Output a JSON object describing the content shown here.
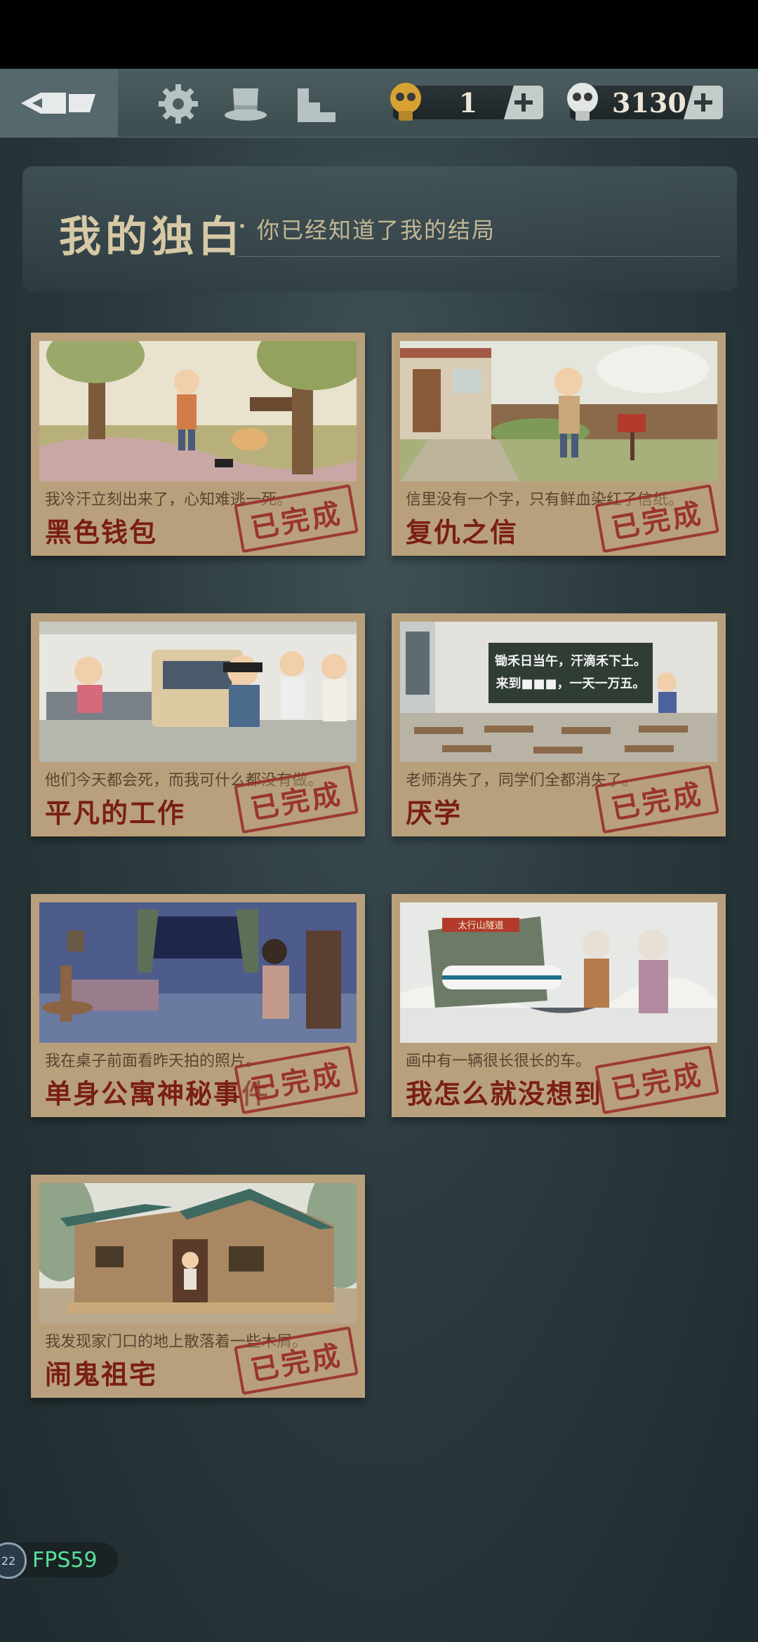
{
  "header": {
    "title": "我的独白",
    "subtitle": "你已经知道了我的结局"
  },
  "currency": {
    "hint": "1",
    "coins": "3130",
    "plus_label": "+"
  },
  "icons": {
    "back": "pen-nib-back-icon",
    "settings": "gear-icon",
    "hat": "top-hat-icon",
    "rank": "stairs-icon",
    "hint": "lightbulb-icon",
    "coin": "lightbulb-coin-icon"
  },
  "stamp_text": "已完成",
  "cards": [
    {
      "desc": "我冷汗立刻出来了，心知难逃一死。",
      "title": "黑色钱包",
      "status": "已完成"
    },
    {
      "desc": "信里没有一个字，只有鲜血染红了信纸。",
      "title": "复仇之信",
      "status": "已完成"
    },
    {
      "desc": "他们今天都会死，而我可什么都没有做。",
      "title": "平凡的工作",
      "status": "已完成"
    },
    {
      "desc": "老师消失了，同学们全都消失了。",
      "title": "厌学",
      "status": "已完成"
    },
    {
      "desc": "我在桌子前面看昨天拍的照片。",
      "title": "单身公寓神秘事件",
      "status": "已完成"
    },
    {
      "desc": "画中有一辆很长很长的车。",
      "title": "我怎么就没想到",
      "status": "已完成"
    },
    {
      "desc": "我发现家门口的地上散落着一些木屑。",
      "title": "闹鬼祖宅",
      "status": "已完成"
    }
  ],
  "art_text": {
    "blackboard_line1": "锄禾日当午，汗滴禾下土。",
    "blackboard_line2": "来到■■■，一天一万五。",
    "station_sign": "太行山隧道"
  },
  "fps": {
    "badge": "22",
    "label": "FPS59"
  }
}
